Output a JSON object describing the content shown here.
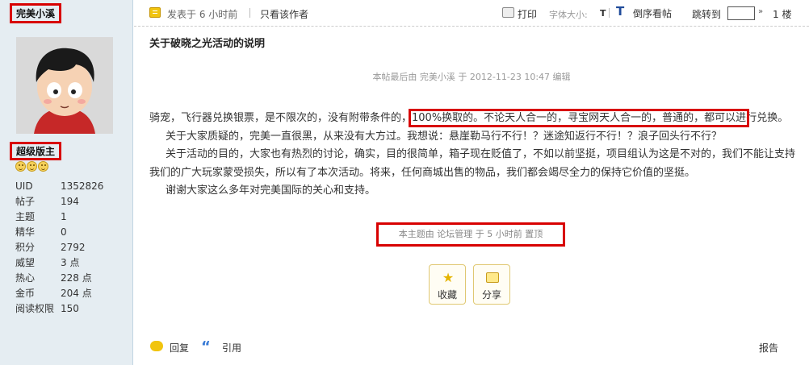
{
  "author": {
    "username": "完美小溪",
    "rank": "超级版主",
    "stats": [
      {
        "key": "UID",
        "value": "1352826"
      },
      {
        "key": "帖子",
        "value": "194"
      },
      {
        "key": "主题",
        "value": "1"
      },
      {
        "key": "精华",
        "value": "0"
      },
      {
        "key": "积分",
        "value": "2792"
      },
      {
        "key": "威望",
        "value": "3 点"
      },
      {
        "key": "热心",
        "value": "228 点"
      },
      {
        "key": "金币",
        "value": "204 点"
      },
      {
        "key": "阅读权限",
        "value": "150"
      }
    ]
  },
  "topbar": {
    "posted": "发表于  6 小时前",
    "only_author": "只看该作者",
    "print": "打印",
    "font_size": "字体大小:",
    "font_size_t": "T",
    "reverse": "倒序看帖",
    "jump_to": "跳转到",
    "floor": "1 楼"
  },
  "post": {
    "title": "关于破晓之光活动的说明",
    "edited": "本帖最后由  完美小溪  于  2012-11-23 10:47 编辑",
    "p1_a": "骑宠，飞行器兑换银票，是不限次的，没有附带条件的，",
    "p1_b": "100%换取的。不论天人合一的，寻宝网天人合一的，普通的，都可以进",
    "p1_c": "行兑换。",
    "p2": "关于大家质疑的，完美一直很黑，从来没有大方过。我想说：悬崖勒马行不行！？迷途知返行不行！？浪子回头行不行？",
    "p3": "关于活动的目的，大家也有热烈的讨论，确实，目的很简单，箱子现在贬值了，不如以前坚挺，项目组认为这是不对的，我们不能让支持我们的广大玩家蒙受损失，所以有了本次活动。将来，任何商城出售的物品，我们都会竭尽全力的保持它价值的坚挺。",
    "p4": "谢谢大家这么多年对完美国际的关心和支持。",
    "sticky": "本主题由  论坛管理  于  5 小时前  置顶"
  },
  "actions": {
    "favorite": "收藏",
    "share": "分享"
  },
  "bottombar": {
    "reply": "回复",
    "quote": "引用",
    "report": "报告"
  }
}
